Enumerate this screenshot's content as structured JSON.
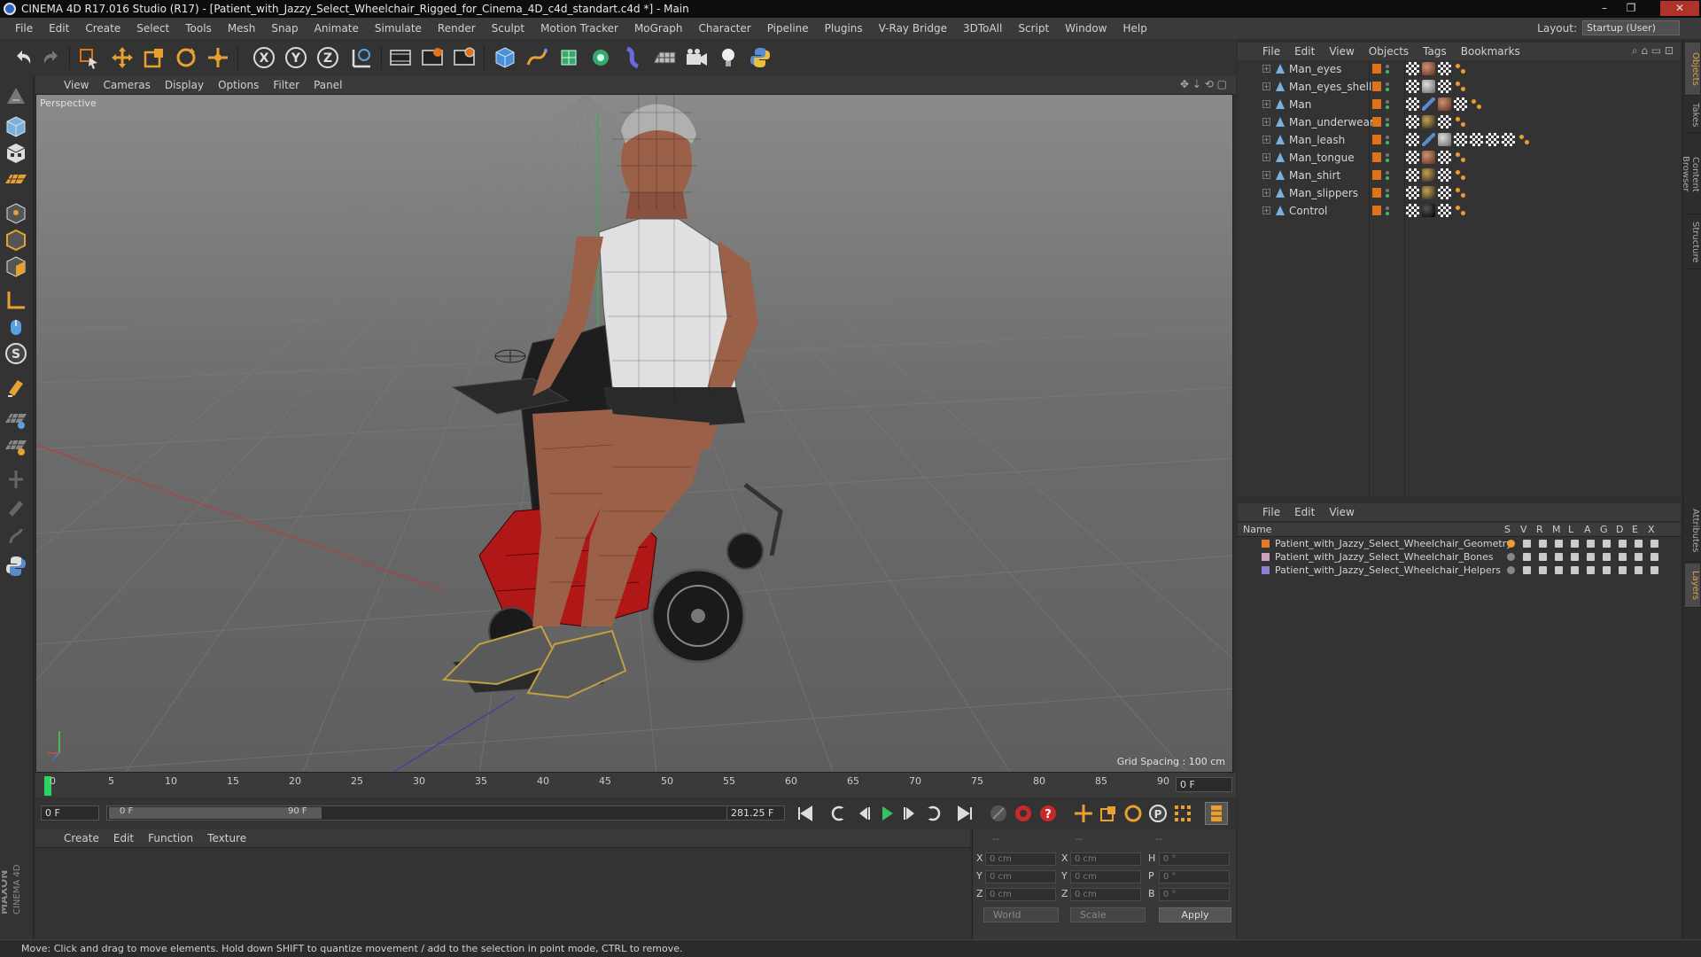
{
  "window": {
    "title": "CINEMA 4D R17.016 Studio (R17) - [Patient_with_Jazzy_Select_Wheelchair_Rigged_for_Cinema_4D_c4d_standart.c4d *] - Main",
    "controls": [
      "–",
      "❐",
      "✕"
    ]
  },
  "menubar": {
    "items": [
      "File",
      "Edit",
      "Create",
      "Select",
      "Tools",
      "Mesh",
      "Snap",
      "Animate",
      "Simulate",
      "Render",
      "Sculpt",
      "Motion Tracker",
      "MoGraph",
      "Character",
      "Pipeline",
      "Plugins",
      "V-Ray Bridge",
      "3DToAll",
      "Script",
      "Window",
      "Help"
    ],
    "layout_label": "Layout:",
    "layout_value": "Startup (User)"
  },
  "toolbar": {
    "icons": [
      "undo-icon",
      "redo-icon",
      "live-selection-icon",
      "move-icon",
      "scale-icon",
      "rotate-icon",
      "transform-icon",
      "x-axis-icon",
      "y-axis-icon",
      "z-axis-icon",
      "world-coord-icon",
      "render-view-icon",
      "render-picture-viewer-icon",
      "render-settings-icon",
      "cube-icon",
      "pen-icon",
      "subdivision-icon",
      "cloner-icon",
      "deformer-icon",
      "floor-icon",
      "camera-icon",
      "light-icon",
      "python-icon"
    ],
    "axis_labels": [
      "X",
      "Y",
      "Z"
    ]
  },
  "left_toolbar": {
    "icons": [
      "make-editable-icon",
      "model-mode-icon",
      "texture-mode-icon",
      "workplane-icon",
      "points-mode-icon",
      "edges-mode-icon",
      "polygons-mode-icon",
      "axis-mode-icon",
      "tweak-icon",
      "snap-s-icon",
      "magnet-icon",
      "grid-snap-icon",
      "planar-icon",
      "sculpt-icon",
      "paint-icon",
      "brush-icon",
      "python-script-icon"
    ]
  },
  "viewport": {
    "menu": [
      "View",
      "Cameras",
      "Display",
      "Options",
      "Filter",
      "Panel"
    ],
    "label": "Perspective",
    "grid_spacing": "Grid Spacing : 100 cm"
  },
  "timeline": {
    "ticks": [
      "0",
      "5",
      "10",
      "15",
      "20",
      "25",
      "30",
      "35",
      "40",
      "45",
      "50",
      "55",
      "60",
      "65",
      "70",
      "75",
      "80",
      "85",
      "90"
    ],
    "current_frame": "0 F",
    "start_field": "0 F",
    "range_start": "0 F",
    "range_end": "90 F",
    "fps_field": "281.25 F"
  },
  "material_manager": {
    "menu": [
      "Create",
      "Edit",
      "Function",
      "Texture"
    ]
  },
  "coordinates": {
    "headers": [
      "--",
      "--",
      "--"
    ],
    "rows": [
      {
        "l1": "X",
        "v1": "0 cm",
        "l2": "X",
        "v2": "0 cm",
        "l3": "H",
        "v3": "0 °"
      },
      {
        "l1": "Y",
        "v1": "0 cm",
        "l2": "Y",
        "v2": "0 cm",
        "l3": "P",
        "v3": "0 °"
      },
      {
        "l1": "Z",
        "v1": "0 cm",
        "l2": "Z",
        "v2": "0 cm",
        "l3": "B",
        "v3": "0 °"
      }
    ],
    "mode": "World",
    "transform": "Scale",
    "apply": "Apply"
  },
  "object_manager": {
    "menu": [
      "File",
      "Edit",
      "View",
      "Objects",
      "Tags",
      "Bookmarks"
    ],
    "objects": [
      {
        "name": "Man_eyes",
        "tags": [
          "checker",
          "sphere-brown",
          "checker",
          "dots"
        ]
      },
      {
        "name": "Man_eyes_shell",
        "tags": [
          "checker",
          "sphere-grey",
          "checker",
          "dots"
        ]
      },
      {
        "name": "Man",
        "tags": [
          "checker",
          "ik",
          "sphere-brown",
          "checker",
          "dots"
        ]
      },
      {
        "name": "Man_underwear",
        "tags": [
          "checker",
          "sphere-dark",
          "checker",
          "dots"
        ]
      },
      {
        "name": "Man_leash",
        "tags": [
          "checker",
          "ik",
          "sphere-grey",
          "checker",
          "checker",
          "checker",
          "checker",
          "dots"
        ]
      },
      {
        "name": "Man_tongue",
        "tags": [
          "checker",
          "sphere-brown",
          "checker",
          "dots"
        ]
      },
      {
        "name": "Man_shirt",
        "tags": [
          "checker",
          "sphere-dark",
          "checker",
          "dots"
        ]
      },
      {
        "name": "Man_slippers",
        "tags": [
          "checker",
          "sphere-dark",
          "checker",
          "dots"
        ]
      },
      {
        "name": "Control",
        "tags": [
          "checker",
          "sphere-black",
          "checker",
          "dots"
        ]
      }
    ]
  },
  "layer_manager": {
    "menu": [
      "File",
      "Edit",
      "View"
    ],
    "columns": [
      "Name",
      "S",
      "V",
      "R",
      "M",
      "L",
      "A",
      "G",
      "D",
      "E",
      "X"
    ],
    "layers": [
      {
        "name": "Patient_with_Jazzy_Select_Wheelchair_Geometry",
        "color": "#e07a2a"
      },
      {
        "name": "Patient_with_Jazzy_Select_Wheelchair_Bones",
        "color": "#c9a0c0"
      },
      {
        "name": "Patient_with_Jazzy_Select_Wheelchair_Helpers",
        "color": "#8a7fd0"
      }
    ]
  },
  "right_tabs": [
    "Objects",
    "Takes",
    "Content Browser",
    "Structure",
    "Attributes",
    "Layers"
  ],
  "status": "Move: Click and drag to move elements. Hold down SHIFT to quantize movement / add to the selection in point mode, CTRL to remove.",
  "brand": {
    "line1": "MAXON",
    "line2": "CINEMA 4D"
  },
  "colors": {
    "accent": "#e0731a",
    "playhead": "#2fd35f",
    "close": "#b0322a"
  }
}
